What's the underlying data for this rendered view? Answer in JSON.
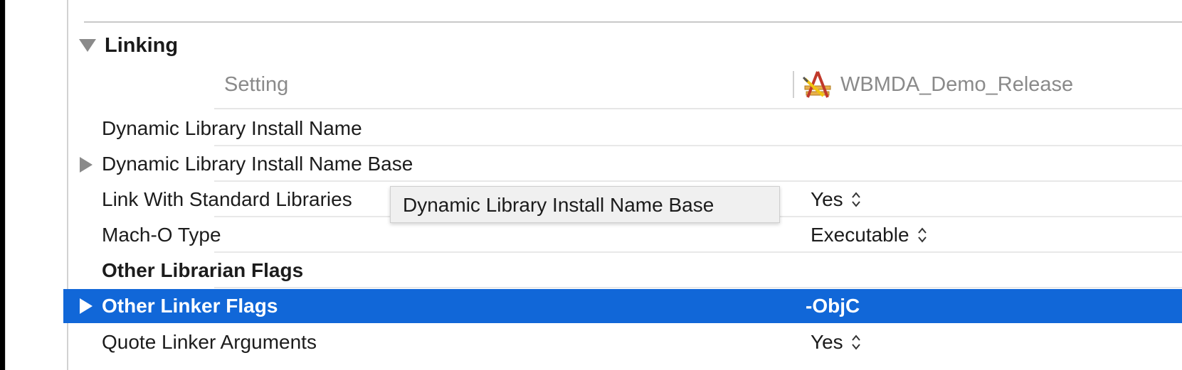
{
  "section": {
    "title": "Linking"
  },
  "columns": {
    "setting": "Setting",
    "target": "WBMDA_Demo_Release"
  },
  "rows": [
    {
      "name": "Dynamic Library Install Name",
      "value": ""
    },
    {
      "name": "Dynamic Library Install Name Base",
      "value": ""
    },
    {
      "name": "Link With Standard Libraries",
      "value": "Yes"
    },
    {
      "name": "Mach-O Type",
      "value": "Executable"
    },
    {
      "name": "Other Librarian Flags",
      "value": ""
    },
    {
      "name": "Other Linker Flags",
      "value": "-ObjC"
    },
    {
      "name": "Quote Linker Arguments",
      "value": "Yes"
    }
  ],
  "tooltip": {
    "text": "Dynamic Library Install Name Base"
  },
  "colors": {
    "selection": "#1167d8",
    "tooltip_bg": "#f0f0f0"
  },
  "icons": {
    "target": "app-target-icon",
    "disclosure_open": "disclosure-down-icon",
    "disclosure_closed": "disclosure-right-icon",
    "stepper": "stepper-icon"
  }
}
